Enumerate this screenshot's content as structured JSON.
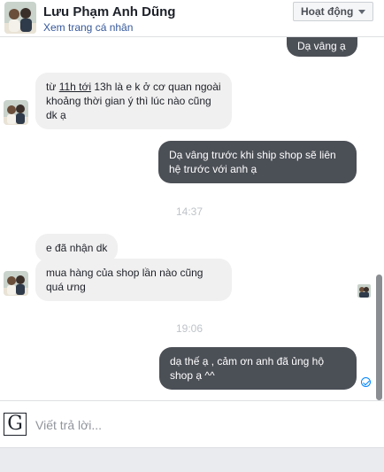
{
  "header": {
    "name": "Lưu Phạm Anh Dũng",
    "profile_link": "Xem trang cá nhân",
    "status": "Hoạt động"
  },
  "messages": {
    "top_partial": "Dạ vâng ạ",
    "in_1_pre": "từ ",
    "in_1_link": "11h tới",
    "in_1_post": " 13h là e k ở cơ quan ngoài khoảng thời gian ý thì lúc nào cũng dk ạ",
    "out_1": "Dạ vâng trước khi ship shop sẽ liên hệ trước với anh ạ",
    "time_1": "14:37",
    "in_2": "e đã nhận dk",
    "in_3": "mua hàng của shop lần nào cũng quá ưng",
    "time_2": "19:06",
    "out_2": "dạ thế ạ , cảm ơn anh đã ủng hộ shop ạ ^^"
  },
  "composer": {
    "g_label": "G",
    "placeholder": "Viết trả lời..."
  },
  "colors": {
    "outgoing_bubble": "#4b4f56",
    "incoming_bubble": "#f1f0f0",
    "link": "#365899",
    "sent_check": "#0084ff"
  },
  "icons": [
    "person-avatar",
    "chevron-down-icon",
    "seen-avatar-icon",
    "sent-check-icon",
    "g-icon"
  ]
}
